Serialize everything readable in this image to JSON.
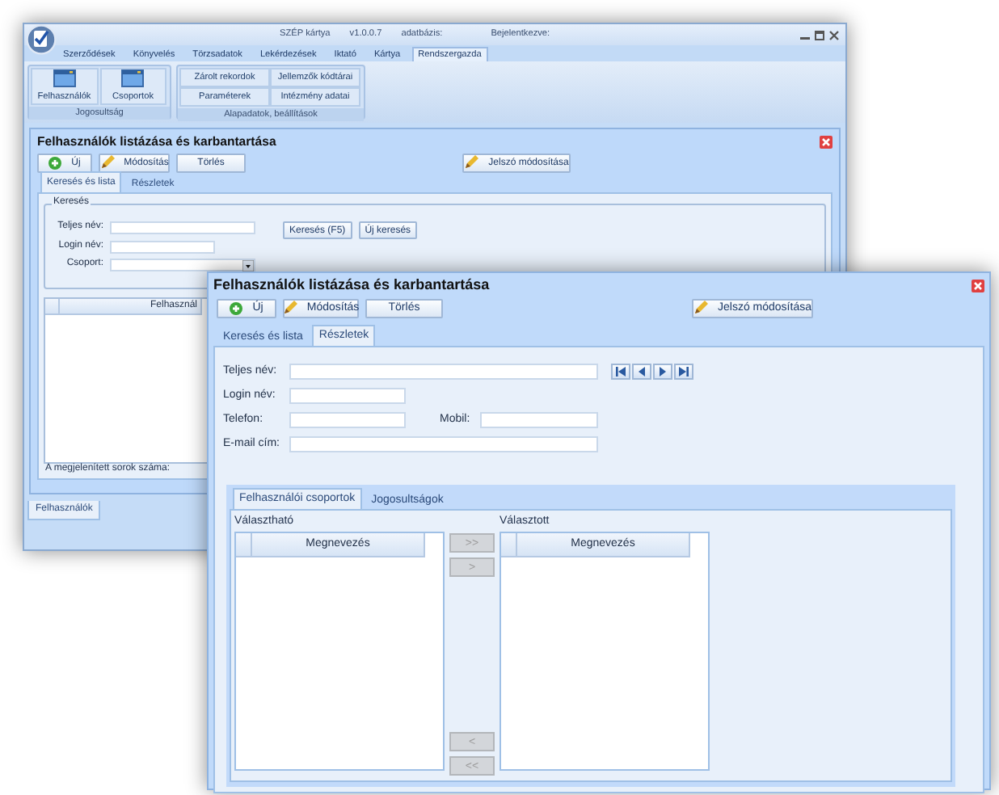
{
  "back_window": {
    "title_bar": {
      "app_name": "SZÉP kártya",
      "version": "v1.0.0.7",
      "database_label": "adatbázis:",
      "login_label": "Bejelentkezve:"
    },
    "menu": [
      {
        "label": "Szerződések",
        "selected": false
      },
      {
        "label": "Könyvelés",
        "selected": false
      },
      {
        "label": "Törzsadatok",
        "selected": false
      },
      {
        "label": "Lekérdezések",
        "selected": false
      },
      {
        "label": "Iktató",
        "selected": false
      },
      {
        "label": "Kártya",
        "selected": false
      },
      {
        "label": "Rendszergazda",
        "selected": true
      }
    ],
    "ribbon": [
      {
        "title": "Jogosultság",
        "items": [
          {
            "label": "Felhasználók",
            "kind": "large"
          },
          {
            "label": "Csoportok",
            "kind": "large"
          }
        ]
      },
      {
        "title": "Alapadatok, beállítások",
        "items": [
          {
            "label": "Zárolt rekordok",
            "kind": "small"
          },
          {
            "label": "Jellemzők kódtárai",
            "kind": "small"
          },
          {
            "label": "Paraméterek",
            "kind": "small"
          },
          {
            "label": "Intézmény adatai",
            "kind": "small"
          }
        ]
      }
    ],
    "form": {
      "title": "Felhasználók listázása és karbantartása",
      "toolbar": [
        {
          "label": "Új",
          "kind": "add"
        },
        {
          "label": "Módosítás",
          "kind": "edit"
        },
        {
          "label": "Törlés",
          "kind": "plain"
        }
      ],
      "password_button": {
        "label": "Jelszó módosítása",
        "kind": "edit"
      },
      "tabs": [
        {
          "label": "Keresés és lista",
          "selected": true
        },
        {
          "label": "Részletek",
          "selected": false
        }
      ],
      "search": {
        "title": "Keresés",
        "fields": [
          {
            "label": "Teljes név:",
            "kind": "text"
          },
          {
            "label": "Login név:",
            "kind": "short"
          },
          {
            "label": "Csoport:",
            "kind": "combo"
          }
        ],
        "buttons": [
          "Keresés (F5)",
          "Új keresés"
        ]
      },
      "grid": {
        "columns": [
          "Felhasznál"
        ]
      },
      "row_count_label": "A megjelenített sorok száma:"
    },
    "bottom_tabs": [
      {
        "label": "Felhasználók",
        "selected": true
      }
    ]
  },
  "front_window": {
    "title": "Felhasználók listázása és karbantartása",
    "toolbar": [
      {
        "label": "Új",
        "kind": "add"
      },
      {
        "label": "Módosítás",
        "kind": "edit"
      },
      {
        "label": "Törlés",
        "kind": "plain"
      }
    ],
    "password_button": {
      "label": "Jelszó módosítása",
      "kind": "edit"
    },
    "tabs": [
      {
        "label": "Keresés és lista",
        "selected": false
      },
      {
        "label": "Részletek",
        "selected": true
      }
    ],
    "rows": [
      {
        "fields": [
          {
            "label": "Teljes név:",
            "kind": "wide"
          }
        ]
      },
      {
        "fields": [
          {
            "label": "Login név:",
            "kind": "short"
          }
        ]
      },
      {
        "fields": [
          {
            "label": "Telefon:",
            "kind": "short"
          },
          {
            "label": "Mobil:",
            "kind": "short"
          }
        ]
      },
      {
        "fields": [
          {
            "label": "E-mail cím:",
            "kind": "wide"
          }
        ]
      }
    ],
    "inner_tabs": [
      {
        "label": "Felhasználói csoportok",
        "selected": true
      },
      {
        "label": "Jogosultságok",
        "selected": false
      }
    ],
    "available": {
      "label": "Választható",
      "columns": [
        "Megnevezés"
      ]
    },
    "chosen": {
      "label": "Választott",
      "columns": [
        "Megnevezés"
      ]
    },
    "transfer_buttons": [
      {
        "label": ">>",
        "disabled": true
      },
      {
        "label": ">",
        "disabled": true
      },
      {
        "label": "<",
        "disabled": true
      },
      {
        "label": "<<",
        "disabled": true
      }
    ]
  }
}
